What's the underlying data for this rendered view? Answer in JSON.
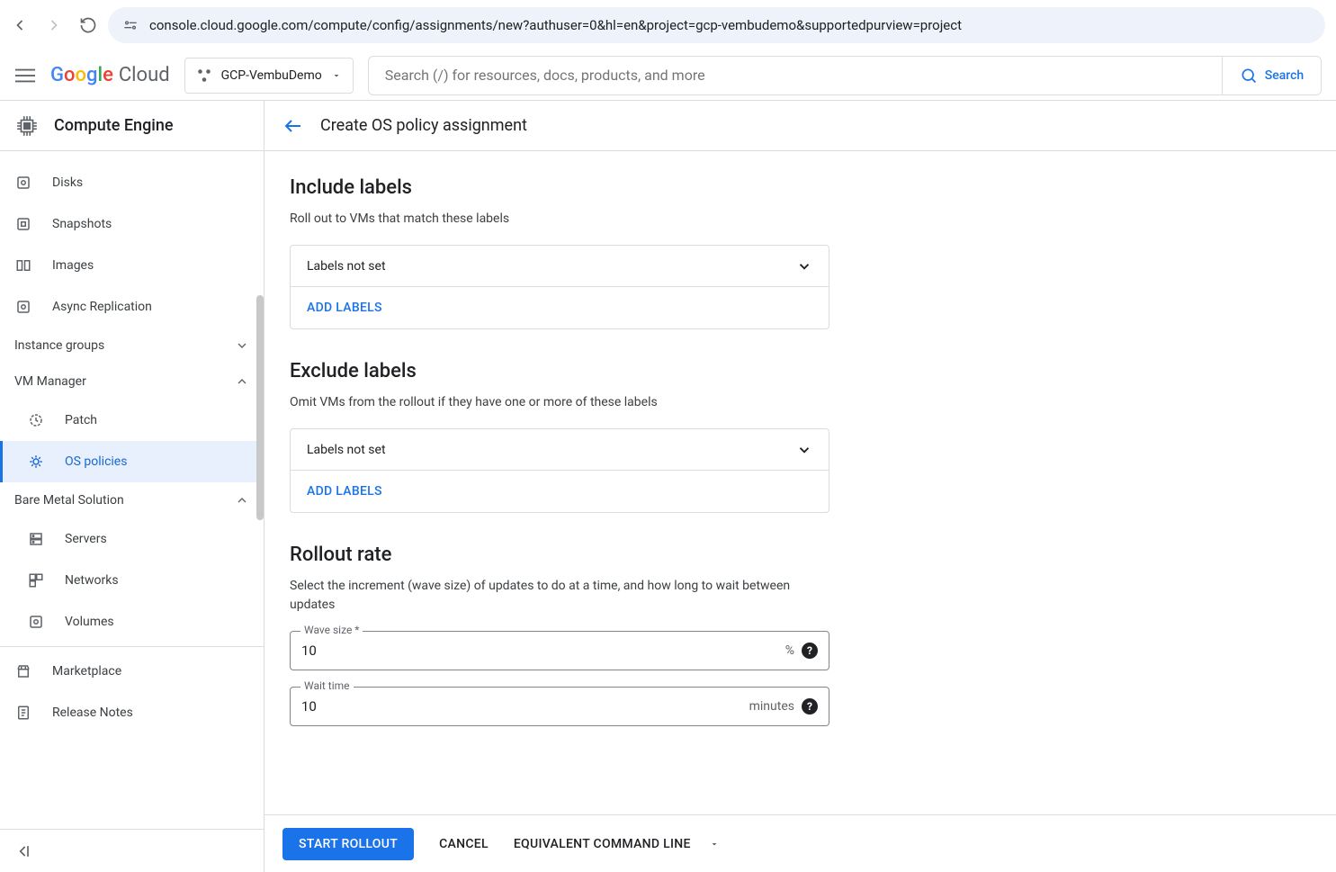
{
  "browser": {
    "url": "console.cloud.google.com/compute/config/assignments/new?authuser=0&hl=en&project=gcp-vembudemo&supportedpurview=project"
  },
  "header": {
    "logo_google": "Google",
    "logo_cloud": "Cloud",
    "project_name": "GCP-VembuDemo",
    "search_placeholder": "Search (/) for resources, docs, products, and more",
    "search_button": "Search"
  },
  "sidebar": {
    "title": "Compute Engine",
    "items": [
      {
        "label": "Disks"
      },
      {
        "label": "Snapshots"
      },
      {
        "label": "Images"
      },
      {
        "label": "Async Replication"
      }
    ],
    "group_instance": "Instance groups",
    "group_vmmanager": "VM Manager",
    "vm_items": [
      {
        "label": "Patch"
      },
      {
        "label": "OS policies"
      }
    ],
    "group_baremetal": "Bare Metal Solution",
    "bm_items": [
      {
        "label": "Servers"
      },
      {
        "label": "Networks"
      },
      {
        "label": "Volumes"
      }
    ],
    "footer_items": [
      {
        "label": "Marketplace"
      },
      {
        "label": "Release Notes"
      }
    ]
  },
  "content": {
    "title": "Create OS policy assignment",
    "include": {
      "heading": "Include labels",
      "desc": "Roll out to VMs that match these labels",
      "value": "Labels not set",
      "add": "ADD LABELS"
    },
    "exclude": {
      "heading": "Exclude labels",
      "desc": "Omit VMs from the rollout if they have one or more of these labels",
      "value": "Labels not set",
      "add": "ADD LABELS"
    },
    "rollout": {
      "heading": "Rollout rate",
      "desc": "Select the increment (wave size) of updates to do at a time, and how long to wait between updates",
      "wave_label": "Wave size *",
      "wave_value": "10",
      "wave_unit": "%",
      "wait_label": "Wait time",
      "wait_value": "10",
      "wait_unit": "minutes"
    },
    "footer": {
      "start": "START ROLLOUT",
      "cancel": "CANCEL",
      "cmdline": "EQUIVALENT COMMAND LINE"
    }
  }
}
